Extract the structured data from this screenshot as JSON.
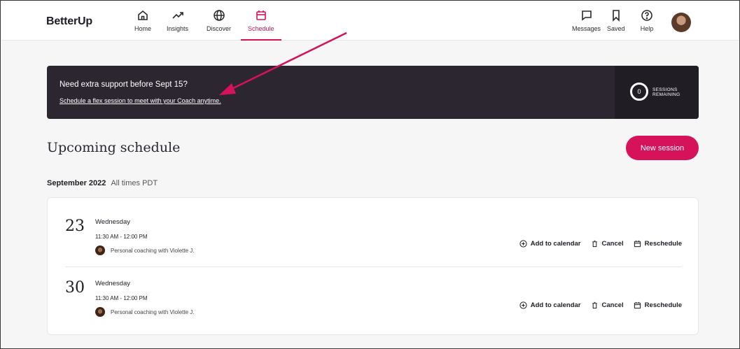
{
  "app": {
    "logo": "BetterUp"
  },
  "nav": {
    "left": [
      {
        "label": "Home",
        "icon": "home-icon"
      },
      {
        "label": "Insights",
        "icon": "insights-icon"
      },
      {
        "label": "Discover",
        "icon": "globe-icon"
      },
      {
        "label": "Schedule",
        "icon": "calendar-icon",
        "active": true
      }
    ],
    "right": [
      {
        "label": "Messages",
        "icon": "message-icon"
      },
      {
        "label": "Saved",
        "icon": "bookmark-icon"
      },
      {
        "label": "Help",
        "icon": "help-icon"
      }
    ]
  },
  "banner": {
    "title": "Need extra support before Sept 15?",
    "link": "Schedule a flex session to meet with your Coach anytime.",
    "sessions_count": "0",
    "sessions_label": "SESSIONS REMAINING"
  },
  "schedule": {
    "heading": "Upcoming schedule",
    "new_session": "New session",
    "month": "September 2022",
    "timezone": "All times PDT",
    "sessions": [
      {
        "day": "23",
        "weekday": "Wednesday",
        "time": "11:30 AM - 12:00 PM",
        "coach": "Personal coaching with Violette J."
      },
      {
        "day": "30",
        "weekday": "Wednesday",
        "time": "11:30 AM - 12:00 PM",
        "coach": "Personal coaching with Violette J."
      }
    ],
    "actions": {
      "add_calendar": "Add to calendar",
      "cancel": "Cancel",
      "reschedule": "Reschedule"
    }
  },
  "colors": {
    "accent": "#d6135a",
    "banner_bg": "#2b2630",
    "page_bg": "#f6f6f6"
  }
}
